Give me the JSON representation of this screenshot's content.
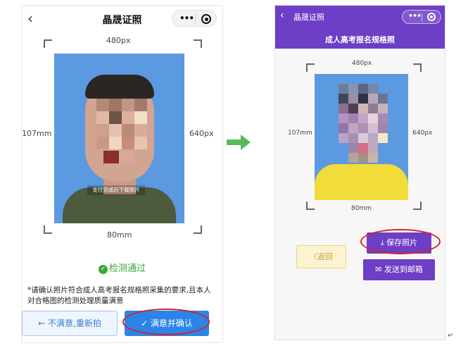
{
  "left_screen": {
    "nav_title": "晶晟证照",
    "back_glyph": "‹",
    "menu_glyph": "•••",
    "photo_width_label": "480px",
    "photo_height_label": "640px",
    "paper_height_label": "107mm",
    "paper_width_label": "80mm",
    "watermark": "支付完成后下载照片",
    "status_icon": "check-circle-icon",
    "status_text": "检测通过",
    "notice_line1": "*请确认照片符合成人高考报名规格照采集的要求,且本人",
    "notice_line2": "对合格图的检测处理质量满意",
    "retake_button": "← 不满意,重新拍",
    "confirm_button": "✓ 满意并确认"
  },
  "right_screen": {
    "nav_title": "晶晟证照",
    "back_glyph": "‹",
    "menu_glyph": "•••",
    "subtitle": "成人高考报名规格照",
    "photo_width_label": "480px",
    "photo_height_label": "640px",
    "paper_height_label": "107mm",
    "paper_width_label": "80mm",
    "back_button": "〈返回",
    "save_button": "⤓ 保存照片",
    "email_button": "✉ 发送到邮箱"
  },
  "transition_icon": "right-arrow-icon",
  "colors": {
    "photo_background": "#5b9ae0",
    "brand_blue": "#2d84e8",
    "brand_purple": "#6d3ec6",
    "pass_green": "#3aa63a",
    "highlight_red": "#d4202a",
    "arrow_green": "#5cb85c"
  },
  "misc": {
    "return_mark": "↵"
  }
}
